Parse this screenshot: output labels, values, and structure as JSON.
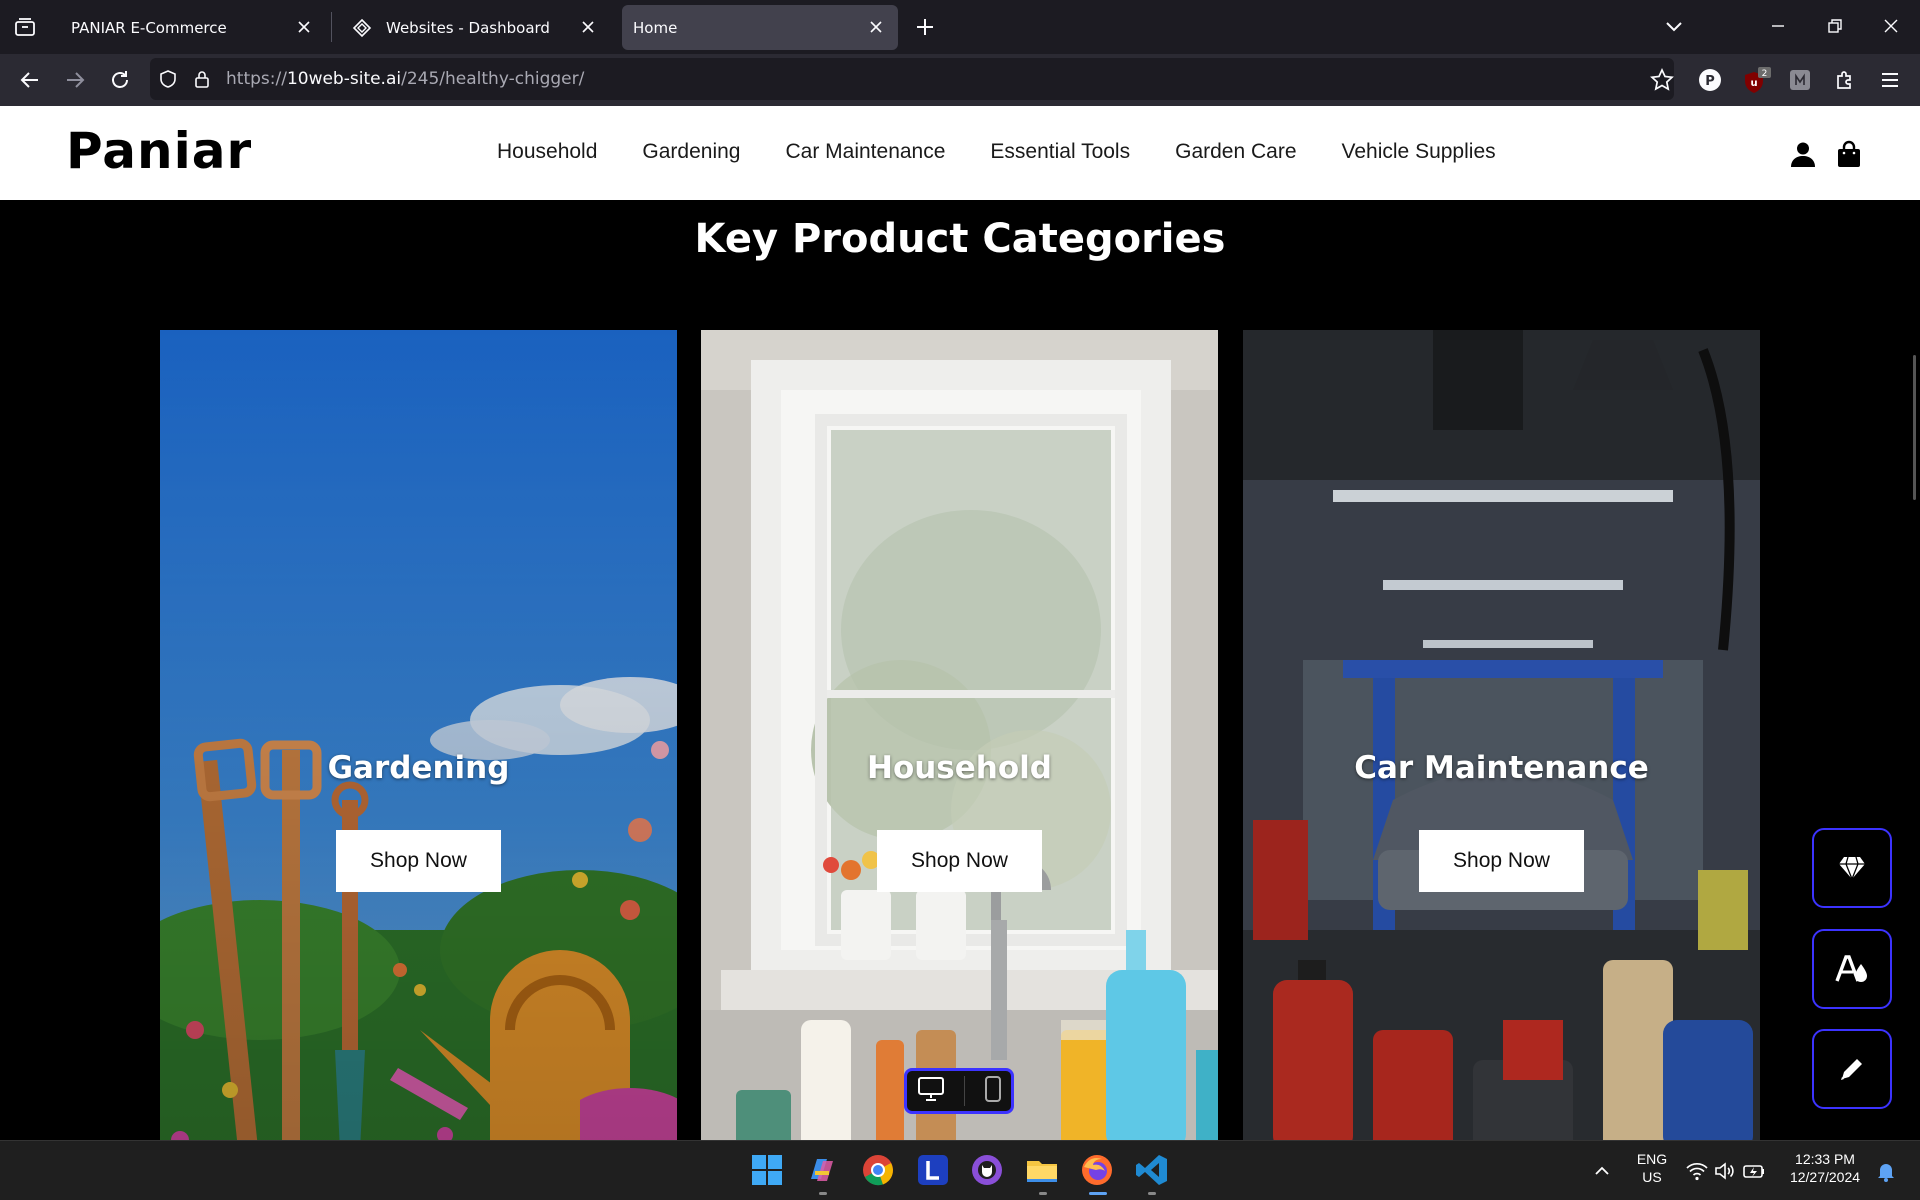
{
  "browser": {
    "tabs": [
      {
        "title": "PANIAR E-Commerce",
        "active": false
      },
      {
        "title": "Websites - Dashboard",
        "active": false
      },
      {
        "title": "Home",
        "active": true
      }
    ],
    "url": {
      "prefix": "https://",
      "host": "10web-site.ai",
      "path": "/245/healthy-chigger/"
    },
    "extensions": [
      {
        "icon": "profile-p-icon",
        "label": "P"
      },
      {
        "icon": "ublock-icon",
        "badge": "2"
      },
      {
        "icon": "ext-square-icon"
      },
      {
        "icon": "extensions-puzzle-icon"
      }
    ]
  },
  "site": {
    "logo": "Paniar",
    "menu": [
      "Household",
      "Gardening",
      "Car Maintenance",
      "Essential Tools",
      "Garden Care",
      "Vehicle Supplies"
    ],
    "section_title": "Key Product Categories",
    "cards": [
      {
        "title": "Gardening",
        "button": "Shop Now"
      },
      {
        "title": "Household",
        "button": "Shop Now"
      },
      {
        "title": "Car Maintenance",
        "button": "Shop Now"
      }
    ],
    "accent": "#3c33ff"
  },
  "taskbar": {
    "language": {
      "line1": "ENG",
      "line2": "US"
    },
    "clock": {
      "time": "12:33 PM",
      "date": "12/27/2024"
    }
  }
}
